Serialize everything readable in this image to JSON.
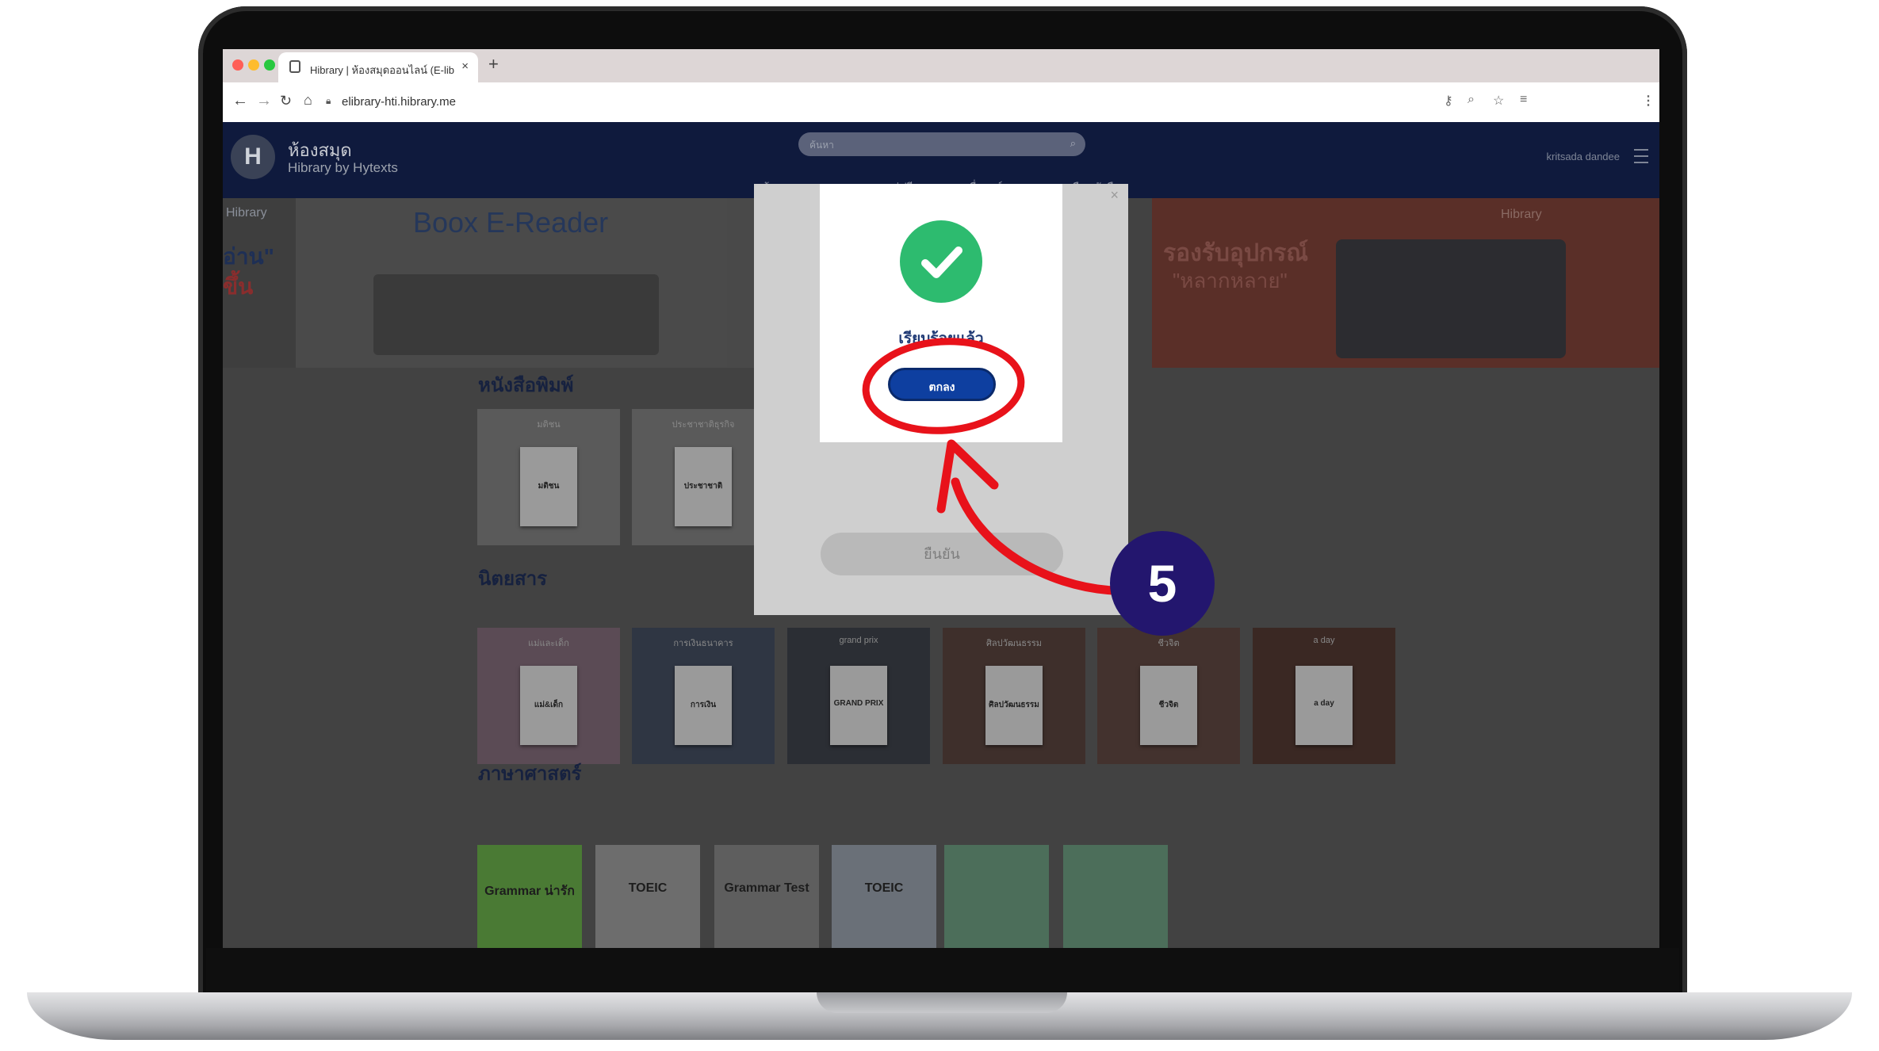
{
  "browser": {
    "tab_title": "Hibrary | ห้องสมุดออนไลน์ (E-lib",
    "tab_close": "×",
    "new_tab": "+",
    "url": "elibrary-hti.hibrary.me"
  },
  "site": {
    "brand_name": "ห้องสมุด",
    "brand_sub": "Hibrary by Hytexts",
    "search_placeholder": "ค้นหา",
    "nav": [
      "ห้องสมุด",
      "เผยแพร่ฟรี",
      "สื่อองค์กร",
      "ยืมหนังสือ"
    ],
    "user_name": "kritsada dandee"
  },
  "banners": {
    "left_brand": "Hibrary",
    "left_text1": "อ่าน\"",
    "left_text2": "ขึ้น",
    "main_title": "Boox E-Reader",
    "right_brand": "Hibrary",
    "right_title": "รองรับอุปกรณ์",
    "right_sub": "\"หลากหลาย\""
  },
  "sections": {
    "newspapers": {
      "title": "หนังสือพิมพ์",
      "items": [
        {
          "label": "มติชน",
          "cover": "มติชน"
        },
        {
          "label": "ประชาชาติธุรกิจ",
          "cover": "ประชาชาติ"
        }
      ]
    },
    "magazines": {
      "title": "นิตยสาร",
      "items": [
        {
          "label": "แม่และเด็ก",
          "cover": "แม่&เด็ก",
          "bg": "#5b4b55"
        },
        {
          "label": "การเงินธนาคาร",
          "cover": "การเงิน",
          "bg": "#2f3643"
        },
        {
          "label": "grand prix",
          "cover": "GRAND PRIX",
          "bg": "#2b2e34"
        },
        {
          "label": "ศิลปวัฒนธรรม",
          "cover": "ศิลปวัฒนธรรม",
          "bg": "#3e2f2b"
        },
        {
          "label": "ชีวจิต",
          "cover": "ชีวจิต",
          "bg": "#43322e"
        },
        {
          "label": "a day",
          "cover": "a day",
          "bg": "#3a2823"
        }
      ]
    },
    "language": {
      "title": "ภาษาศาสตร์",
      "items": [
        "Grammar น่ารัก",
        "TOEIC",
        "Grammar Test",
        "TOEIC",
        "",
        ""
      ]
    }
  },
  "modal": {
    "close": "×",
    "confirm_label": "ยืนยัน",
    "success_message": "เรียบร้อยแล้ว",
    "ok_label": "ตกลง"
  },
  "annotation": {
    "step_number": "5",
    "color": "#e8121a"
  }
}
